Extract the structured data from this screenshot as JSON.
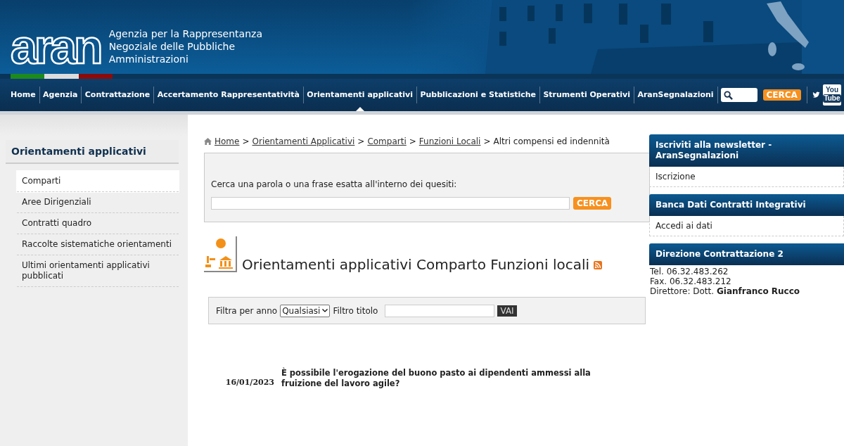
{
  "header": {
    "logo": "aran",
    "agency_name": [
      "Agenzia per la Rappresentanza",
      "Negoziale delle Pubbliche",
      "Amministrazioni"
    ],
    "youtube_icon": [
      "You",
      "Tube"
    ]
  },
  "nav": {
    "items": [
      {
        "label": "Home",
        "selected": false
      },
      {
        "label": "Agenzia",
        "selected": false
      },
      {
        "label": "Contrattazione",
        "selected": false
      },
      {
        "label": "Accertamento Rappresentatività",
        "selected": false
      },
      {
        "label": "Orientamenti applicativi",
        "selected": true
      },
      {
        "label": "Pubblicazioni e Statistiche",
        "selected": false
      },
      {
        "label": "Strumenti Operativi",
        "selected": false
      },
      {
        "label": "AranSegnalazioni",
        "selected": false
      }
    ],
    "search_button": "CERCA"
  },
  "sidebar": {
    "title": "Orientamenti applicativi",
    "items": [
      {
        "label": "Comparti",
        "selected": true
      },
      {
        "label": "Aree Dirigenziali",
        "selected": false
      },
      {
        "label": "Contratti quadro",
        "selected": false
      },
      {
        "label": "Raccolte sistematiche orientamenti",
        "selected": false
      },
      {
        "label": "Ultimi orientamenti applicativi pubblicati",
        "selected": false
      }
    ]
  },
  "breadcrumb": {
    "links": [
      "Home",
      "Orientamenti Applicativi",
      "Comparti",
      "Funzioni Locali"
    ],
    "current": "Altri compensi ed indennità",
    "separator": ">"
  },
  "search_box": {
    "label": "Cerca una parola o una frase esatta all'interno dei quesiti:",
    "button": "CERCA"
  },
  "page_title": "Orientamenti applicativi Comparto Funzioni locali",
  "filter": {
    "year_label": "Filtra per anno",
    "year_value": "Qualsiasi",
    "title_label": "Filtro titolo",
    "button": "VAI"
  },
  "results": [
    {
      "date": "16/01/2023",
      "title": "È possibile l'erogazione del buono pasto ai dipendenti ammessi alla fruizione del lavoro agile?"
    }
  ],
  "right_boxes": [
    {
      "title": "Iscriviti alla newsletter - AranSegnalazioni",
      "kind": "link",
      "link": "Iscrizione"
    },
    {
      "title": "Banca Dati Contratti Integrativi",
      "kind": "link",
      "link": "Accedi ai dati"
    },
    {
      "title": "Direzione Contrattazione 2",
      "kind": "contact",
      "lines": [
        "Tel. 06.32.483.262",
        "Fax. 06.32.483.212"
      ],
      "director_label": "Direttore: Dott.",
      "director_name": "Gianfranco Rucco"
    }
  ]
}
